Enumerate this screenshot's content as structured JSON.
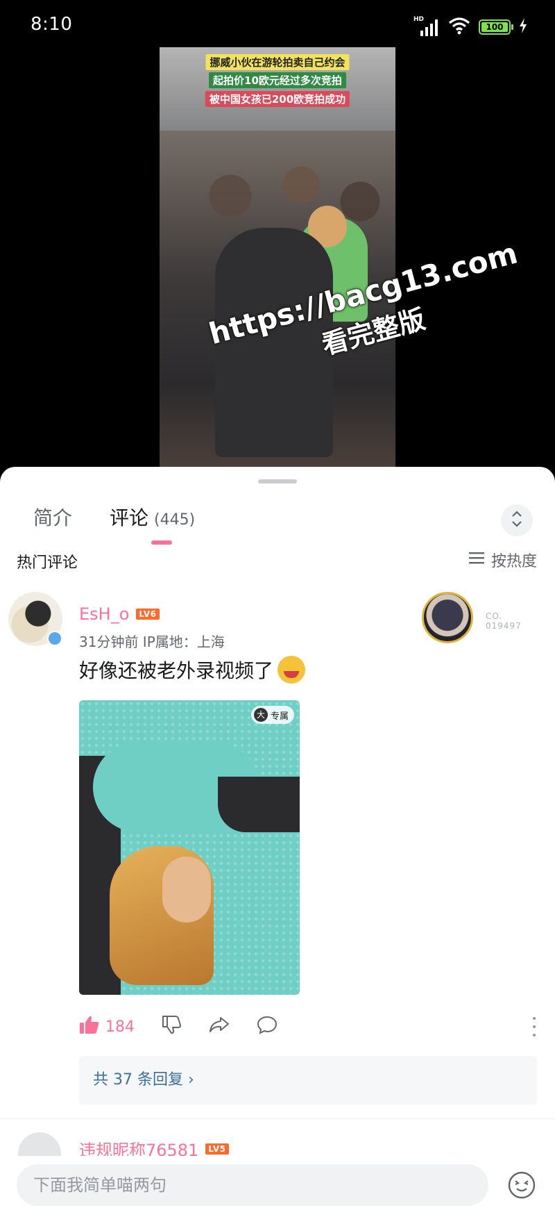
{
  "status_bar": {
    "time": "8:10",
    "signal_label": "HD",
    "battery": "100"
  },
  "video": {
    "captions": [
      "挪威小伙在游轮拍卖自己约会",
      "起拍价10欧元经过多次竞拍",
      "被中国女孩已200欧竞拍成功"
    ],
    "watermark_line1": "https://bacg13.com",
    "watermark_line2": "看完整版"
  },
  "tabs": {
    "intro": "简介",
    "comments": "评论",
    "comments_count": "(445)"
  },
  "section": {
    "hot_comments": "热门评论",
    "sort_label": "按热度"
  },
  "comment": {
    "username": "EsH_o",
    "level": "LV6",
    "meta": "31分钟前 IP属地：上海",
    "fan_badge_no_line1": "CO.",
    "fan_badge_no_line2": "019497",
    "text": "好像还被老外录视频了",
    "sticker_tag": "专属",
    "sticker_tag_icon": "大",
    "likes": "184",
    "replies": "共 37 条回复 ›"
  },
  "comment2": {
    "username": "违规昵称76581",
    "level": "LV5"
  },
  "input": {
    "placeholder": "下面我简单喵两句"
  },
  "colors": {
    "accent_pink": "#fb7299",
    "level_orange": "#fb6c2a",
    "reply_link": "#3a6fa0"
  }
}
